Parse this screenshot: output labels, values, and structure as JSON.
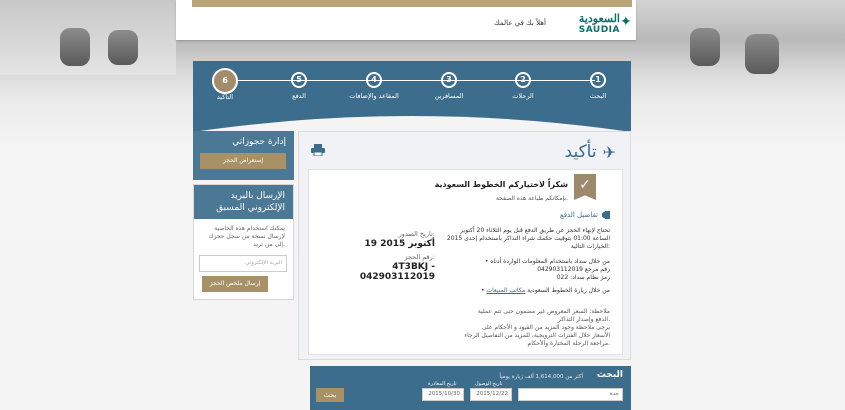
{
  "header": {
    "greeting": "أهلاً بك في عالمك",
    "logo_arabic": "السعودية",
    "logo_english": "SAUDIA"
  },
  "steps": [
    {
      "num": "1",
      "label": "البحث"
    },
    {
      "num": "2",
      "label": "الرحلات"
    },
    {
      "num": "3",
      "label": "المسافرين"
    },
    {
      "num": "4",
      "label": "المقاعد والإضافات"
    },
    {
      "num": "5",
      "label": "الدفع"
    },
    {
      "num": "6",
      "label": "التأكيد"
    }
  ],
  "sidebar": {
    "manage_title": "إدارة حجوزاتي",
    "manage_button": "إستعراض الحجز",
    "email_title": "الإرسال بالبريد الإلكتروني المسبق",
    "email_text": "يمكنك استخدام هذه الخاصية لإرسال نسخة من سجل حجزك إلى من تريد.",
    "email_placeholder": "البريد الإلكتروني",
    "email_button": "إرسال ملخص الحجز"
  },
  "main": {
    "title": "تأكيد",
    "thanks": "شكراً لاختياركم الخطوط السعودية",
    "print_note": "بإمكانكم طباعة هذه الصفحة.",
    "payment_details_title": "تفاصيل الدفع",
    "deadline_text": "تحتاج لإنهاء الحجز عن طريق الدفع قبل يوم الثلاثاء 20 أكتوبر",
    "deadline_time": "2015 الساعة 01:00 بتوقيت حكمك شراء التذاكر باستخدام إحدى",
    "options_heading": "الخيارات التالية:",
    "option1": "• من خلال سداد باستخدام المعلومات الواردة أدناه",
    "option1_ref": "رقم مرجع 042903112019",
    "option1_code": "رمز نظام سداد: 022",
    "option2_prefix": "• من خلال زيارة الخطوط السعودية",
    "option2_link": "مكاتب المبيعات",
    "note1": "ملاحظة: السعر المعروض غير مضمون حتى تتم عملية",
    "note2": "الدفع وإصدار التذاكر.",
    "note3": "يرجى ملاحظة وجود المزيد من القيود و الأحكام على",
    "note4": "الأسعار خلال الفترات الترويجية، للمزيد من التفاصيل الرجاء",
    "note5": "مراجعة الرحلة المختارة والأحكام.",
    "issue_date_label": "تاريخ الصدور:",
    "issue_date_value": "19 أكتوبر 2015",
    "booking_ref_label": "رقم الحجز:",
    "booking_ref_value": "4T3BKJ - 042903112019"
  },
  "search": {
    "title": "البحث",
    "subtitle": "أكثر من 1,614,000 ألف زيارة يومياً",
    "from_value": "جدة",
    "return_label": "تاريخ الوصول",
    "return_value": "2015/12/22",
    "depart_label": "تاريخ المغادرة",
    "depart_value": "2015/10/30",
    "button": "بحث"
  }
}
